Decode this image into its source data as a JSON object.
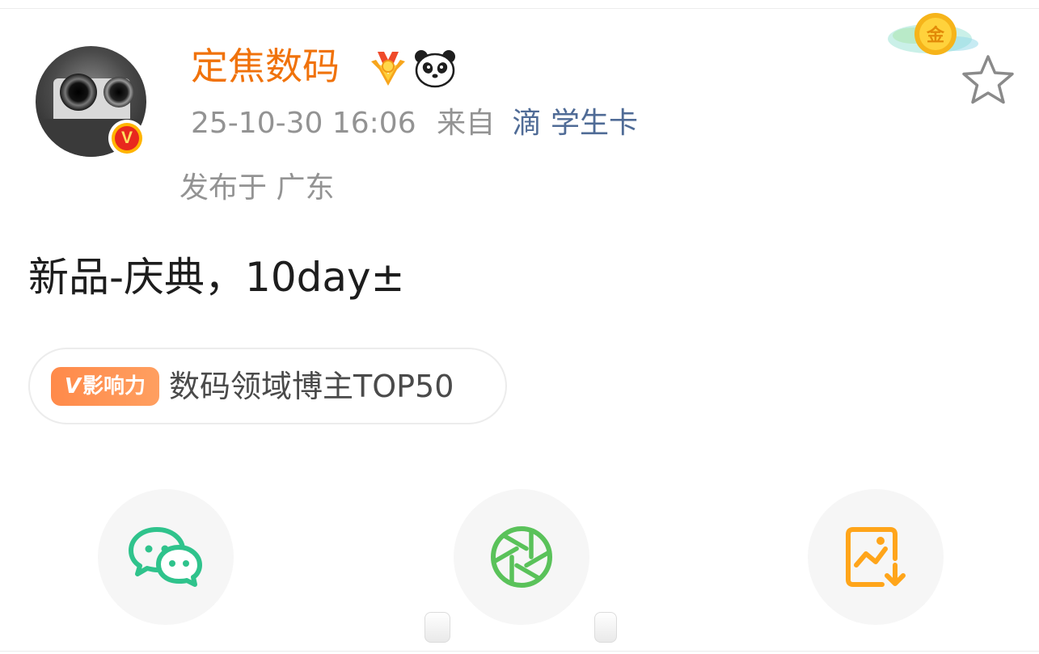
{
  "post": {
    "username": "定焦数码",
    "timestamp": "25-10-30 16:06",
    "source_prefix": "来自",
    "source": "滴 学生卡",
    "location": "发布于 广东",
    "text": "新品-庆典，10day±"
  },
  "influence": {
    "badge_v": "V",
    "badge_label": "影响力",
    "text": "数码领域博主TOP50"
  },
  "badges": {
    "verified_letter": "V",
    "gold_label": "金"
  },
  "icons": {
    "wechat": "wechat-icon",
    "moments": "moments-icon",
    "save_image": "save-image-icon",
    "favorite": "star-icon"
  },
  "colors": {
    "username": "#f0720b",
    "source_link": "#4f6b96",
    "wechat_green": "#2fc38c",
    "moments_green": "#5ac25a",
    "save_orange": "#ffa51a",
    "influence_orange": "#ff8a4a"
  }
}
